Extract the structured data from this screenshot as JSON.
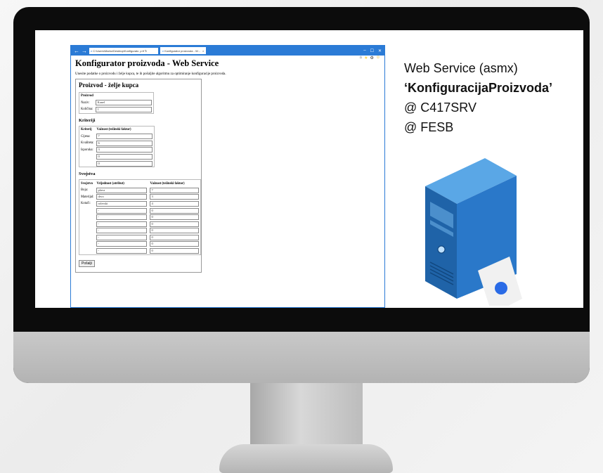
{
  "browser": {
    "address": "C:\\Users\\Marko\\Desktop\\Konfigurato",
    "address_controls": "ρ ▾ ↻",
    "tab_title": "Konfigurator proizvoda - W...",
    "window_controls": {
      "minimize": "–",
      "maximize": "☐",
      "close": "✕"
    }
  },
  "page": {
    "title": "Konfigurator proizvoda - Web Service",
    "intro": "Unesite podatke o proizvodu i želje kupca, te ih pošaljite algoritmu za optimiranje konfiguracije proizvoda.",
    "card_title": "Proizvod - želje kupca",
    "proizvod": {
      "header": "Proizvod",
      "naziv_label": "Naziv:",
      "naziv_value": "Kanel",
      "kolicina_label": "Količina:",
      "kolicina_value": "1"
    },
    "kriteriji": {
      "section_title": "Kriteriji",
      "col1": "Kriterij",
      "col2": "Važnost (težinski faktor)",
      "rows": [
        {
          "label": "Cijena:",
          "value": "7"
        },
        {
          "label": "Kvaliteta:",
          "value": "6"
        },
        {
          "label": "Isporuka:",
          "value": "3"
        },
        {
          "label": "",
          "value": "0"
        },
        {
          "label": "",
          "value": "0"
        }
      ]
    },
    "svojstva": {
      "section_title": "Svojstva",
      "col1": "Svojstvo",
      "col2": "Vrijednost (atribut)",
      "col3": "Važnost (težinski faktor)",
      "rows": [
        {
          "label": "Boja:",
          "attr": "plava",
          "weight": "7"
        },
        {
          "label": "Materijal:",
          "attr": "drvo",
          "weight": "3"
        },
        {
          "label": "Kotači:",
          "attr": "rolerski",
          "weight": "4"
        },
        {
          "label": "",
          "attr": "-",
          "weight": "0"
        },
        {
          "label": "",
          "attr": "-",
          "weight": "0"
        },
        {
          "label": "",
          "attr": "-",
          "weight": "0"
        },
        {
          "label": "",
          "attr": "-",
          "weight": "0"
        },
        {
          "label": "",
          "attr": "-",
          "weight": "0"
        },
        {
          "label": "",
          "attr": "-",
          "weight": "0"
        },
        {
          "label": "",
          "attr": "-",
          "weight": "0"
        }
      ]
    },
    "submit_label": "Pošalji"
  },
  "side": {
    "line1": "Web Service (asmx)",
    "line2": "‘KonfiguracijaProizvoda’",
    "line3": "@ C417SRV",
    "line4": "@ FESB"
  },
  "icons": [
    "back-arrow-icon",
    "forward-arrow-icon",
    "ie-logo-icon",
    "home-icon",
    "star-icon",
    "gear-icon",
    "smiley-icon",
    "server-icon"
  ],
  "colors": {
    "titlebar": "#2b7bd6",
    "server_blue": "#2a78c9"
  }
}
